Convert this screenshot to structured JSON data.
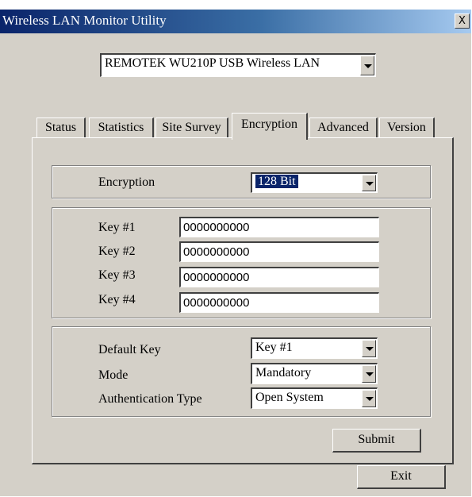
{
  "window": {
    "title": "Wireless LAN Monitor Utility",
    "close_label": "X"
  },
  "adapter": {
    "selected": "REMOTEK WU210P USB Wireless LAN"
  },
  "tabs": [
    {
      "label": "Status"
    },
    {
      "label": "Statistics"
    },
    {
      "label": "Site Survey"
    },
    {
      "label": "Encryption"
    },
    {
      "label": "Advanced"
    },
    {
      "label": "Version"
    }
  ],
  "active_tab": "Encryption",
  "encryption": {
    "label": "Encryption",
    "selected": "128 Bit"
  },
  "keys": [
    {
      "label": "Key #1",
      "value": "0000000000"
    },
    {
      "label": "Key #2",
      "value": "0000000000"
    },
    {
      "label": "Key #3",
      "value": "0000000000"
    },
    {
      "label": "Key #4",
      "value": "0000000000"
    }
  ],
  "settings": {
    "default_key": {
      "label": "Default Key",
      "selected": "Key #1"
    },
    "mode": {
      "label": "Mode",
      "selected": "Mandatory"
    },
    "auth_type": {
      "label": "Authentication Type",
      "selected": "Open System"
    }
  },
  "buttons": {
    "submit": "Submit",
    "exit": "Exit"
  },
  "colors": {
    "titlebar_start": "#0a246a",
    "titlebar_end": "#a6caf0",
    "dialog_face": "#d4d0c8",
    "selection": "#0a246a"
  }
}
